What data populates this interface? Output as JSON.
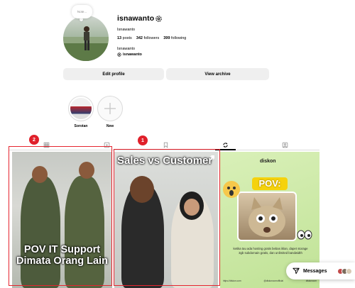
{
  "profile": {
    "note": "Note...",
    "username": "isnawanto",
    "full_name": "Isnawanto",
    "stats": {
      "posts_count": "13",
      "posts_label": "posts",
      "followers_count": "342",
      "followers_label": "followers",
      "following_count": "399",
      "following_label": "following"
    },
    "bio_name": "Isnawanto",
    "threads_handle": "isnawanto"
  },
  "actions": {
    "edit_profile": "Edit profile",
    "view_archive": "View archive"
  },
  "highlights": [
    {
      "label": "Sorotan"
    },
    {
      "label": "New"
    }
  ],
  "tabs": [
    {
      "icon": "grid-icon"
    },
    {
      "icon": "bookmark-icon"
    },
    {
      "icon": "reels-icon",
      "active": true
    },
    {
      "icon": "tagged-icon"
    }
  ],
  "annotations": {
    "badge_1": "1",
    "badge_2": "2"
  },
  "posts": [
    {
      "caption": "POV IT Support Dimata Orang Lain"
    },
    {
      "caption": "Sales vs Customer"
    },
    {
      "brand": "diskon",
      "headline": "POV:",
      "text": "ketika tau ada hosting gratis bebas iklan, dapet storage 3gb subdomain gratis, dan unlimited bandwidth",
      "footer": [
        "https://diskon.com",
        "@diskoncomofficial",
        "diskoncom"
      ]
    }
  ],
  "messages": {
    "label": "Messages"
  },
  "colors": {
    "annotation": "#e0202a",
    "button_bg": "#efefef",
    "ad_yellow": "#f5d20c"
  }
}
